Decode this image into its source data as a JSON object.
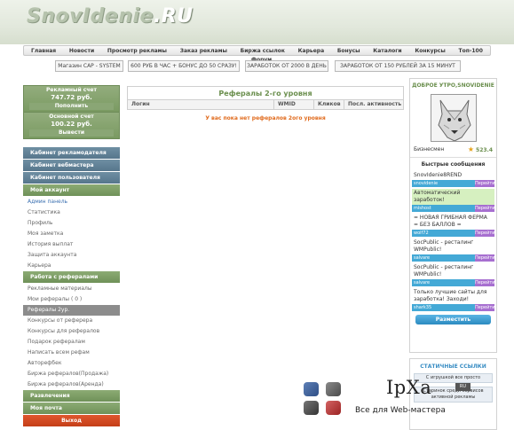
{
  "logo": {
    "main": "SnovIdenie",
    "tld": ".RU"
  },
  "nav": [
    "Главная",
    "Новости",
    "Просмотр рекламы",
    "Заказ рекламы",
    "Биржа ссылок",
    "Карьера",
    "Бонусы",
    "Каталоги",
    "Конкурсы",
    "Топ-100"
  ],
  "forum": "Форум",
  "promos": [
    "Магазин CAP - SYSTEM",
    "600 РУБ В ЧАС + БОНУС ДО 50 СРАЗУ!",
    "ЗАРАБОТОК ОТ 2000 В ДЕНЬ",
    "ЗАРАБОТОК ОТ 150 РУБЛЕЙ ЗА 15 МИНУТ"
  ],
  "accounts": {
    "ad": {
      "label": "Рекламный счет",
      "amount": "747.72 руб.",
      "button": "Пополнить"
    },
    "main": {
      "label": "Основной счет",
      "amount": "100.22 руб.",
      "button": "Вывести"
    }
  },
  "menu": {
    "advertiser": "Кабинет рекламодателя",
    "webmaster": "Кабинет вебмастера",
    "user": "Кабинет пользователя",
    "my_account": "Мой аккаунт",
    "account_items": [
      "Админ панель",
      "Статистика",
      "Профиль",
      "Моя заметка",
      "История выплат",
      "Защита аккаунта",
      "Карьера"
    ],
    "referrals": "Работа с рефералами",
    "ref_items": [
      "Рекламные материалы",
      "Мои рефералы ( 0 )",
      "Рефералы 2ур.",
      "Конкурсы от реферера",
      "Конкурсы для рефералов",
      "Подарок рефералам",
      "Написать всем рефам",
      "Авторефбек",
      "Биржа рефералов(Продажа)",
      "Биржа рефералов(Аренда)"
    ],
    "entertainment": "Развлечения",
    "mail": "Моя почта",
    "logout": "Выход"
  },
  "main": {
    "title": "Рефералы 2-го уровня",
    "columns": [
      "Логин",
      "WMID",
      "Кликов",
      "Посл. активность"
    ],
    "empty": "У вас пока нет рефералов 2ого уровня"
  },
  "profile": {
    "greeting": "ДОБРОЕ УТРО,SNOVIDENIE",
    "role": "Бизнесмен",
    "rating": "523.4"
  },
  "quick": {
    "title": "Быстрые сообщения",
    "messages": [
      {
        "text": "SnovIdenie8REND",
        "user": "snovidenie",
        "hl": false
      },
      {
        "text": "Автоматический заработок!",
        "user": "mishost",
        "hl": true
      },
      {
        "text": "= НОВАЯ ГРИБНАЯ ФЕРМА = БЕЗ БАЛЛОВ =",
        "user": "wolf72",
        "hl": false
      },
      {
        "text": "SocPublic - ресталинг WMPublic!",
        "user": "salvare",
        "hl": false
      },
      {
        "text": "SocPublic - ресталинг WMPublic!",
        "user": "salvare",
        "hl": false
      },
      {
        "text": "Только лучшие сайты для заработка! Заходи!",
        "user": "shark35",
        "hl": false
      }
    ],
    "go": "Перейти",
    "mention": "Разместить"
  },
  "static_links": {
    "title": "СТАТИЧНЫЕ ССЫЛКИ",
    "ads": [
      "С игрушкой все просто",
      "Старинок среди сервисов активной рекламы"
    ]
  },
  "badge": {
    "brand": "IpXa",
    "tag": "RU",
    "tagline": "Все для Web-мастера"
  }
}
